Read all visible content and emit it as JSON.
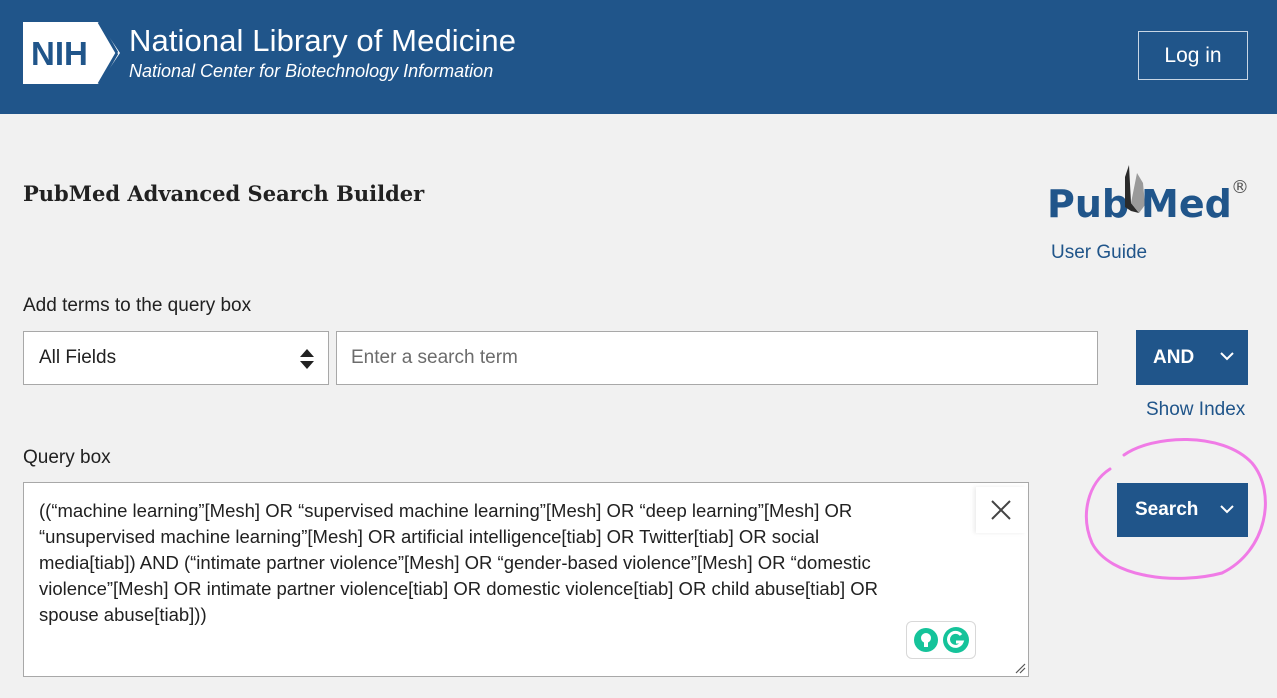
{
  "header": {
    "nih_logo_text": "NIH",
    "title": "National Library of Medicine",
    "subtitle": "National Center for Biotechnology Information",
    "login_label": "Log in"
  },
  "page": {
    "title": "PubMed Advanced Search Builder",
    "logo_text_pub": "Pub",
    "logo_text_med": "Med",
    "logo_registered": "®",
    "user_guide_label": "User Guide"
  },
  "builder": {
    "add_terms_label": "Add terms to the query box",
    "field_select_value": "All Fields",
    "term_placeholder": "Enter a search term",
    "term_value": "",
    "operator_label": "AND",
    "show_index_label": "Show Index"
  },
  "query": {
    "label": "Query box",
    "text": "((“machine learning”[Mesh] OR “supervised machine learning”[Mesh] OR “deep learning”[Mesh] OR\n“unsupervised machine learning”[Mesh] OR artificial intelligence[tiab] OR Twitter[tiab] OR social\nmedia[tiab]) AND (“intimate partner violence”[Mesh] OR “gender-based violence”[Mesh] OR “domestic\nviolence”[Mesh] OR intimate partner violence[tiab] OR domestic violence[tiab] OR child abuse[tiab] OR\nspouse abuse[tiab]))",
    "search_label": "Search"
  },
  "icons": {
    "clear": "close-icon",
    "field_select": "sort-arrows-icon",
    "dropdown": "chevron-down-icon",
    "grammarly_suggest": "lightbulb-icon",
    "grammarly_logo": "grammarly-icon",
    "resize": "resize-handle-icon"
  },
  "colors": {
    "header_bg": "#20558a",
    "accent": "#20558a",
    "page_bg": "#f1f1f1",
    "annotation": "#f07be6",
    "grammarly_green": "#15c39a"
  }
}
